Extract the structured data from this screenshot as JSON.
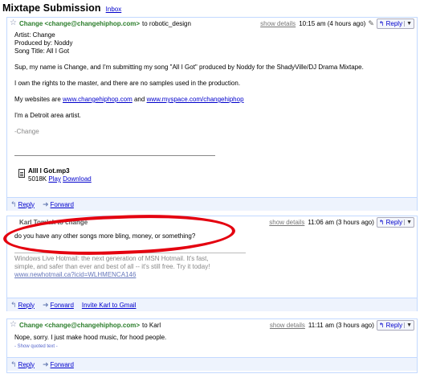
{
  "header": {
    "title": "Mixtape Submission",
    "inbox_label": "Inbox"
  },
  "messages": [
    {
      "sender": "Change <change@changehiphop.com>",
      "to": "to robotic_design",
      "show_details": "show details",
      "time": "10:15 am (4 hours ago)",
      "reply": "Reply",
      "body": {
        "artist": "Artist: Change",
        "produced_by": "Produced by: Noddy",
        "song_title": "Song Title: All I Got",
        "para1": "Sup, my name is Change, and I'm submitting my song \"All I Got\" produced by Noddy for the ShadyVille/DJ Drama Mixtape.",
        "para2": "I own the rights to the master, and there are no samples used in the production.",
        "para3_prefix": "My websites are",
        "link1": "www.changehiphop.com",
        "para3_and": "and",
        "link2": "www.myspace.com/changehiphop",
        "para4": "I'm a Detroit area artist.",
        "signature": "-Change"
      },
      "attachment": {
        "name": "AllI I Got.mp3",
        "size": "5018K",
        "play": "Play",
        "download": "Download"
      },
      "footer": {
        "reply": "Reply",
        "forward": "Forward"
      }
    },
    {
      "sender": "Karl Tomlak to change",
      "show_details": "show details",
      "time": "11:06 am (3 hours ago)",
      "reply": "Reply",
      "body": {
        "question": "do you have any other songs more bling, money, or something?",
        "ad_line1": "Windows Live Hotmail: the next generation of MSN Hotmail. It's fast,",
        "ad_line2": "simple, and safer than ever and best of all -- it's still free. Try it today!",
        "ad_link": "www.newhotmail.ca?icid=WLHMENCA146"
      },
      "footer": {
        "reply": "Reply",
        "forward": "Forward",
        "invite": "Invite Karl to Gmail"
      }
    },
    {
      "sender": "Change <change@changehiphop.com>",
      "to": "to Karl",
      "show_details": "show details",
      "time": "11:11 am (3 hours ago)",
      "reply": "Reply",
      "body": {
        "text": "Nope, sorry. I just make hood music, for hood people.",
        "show_quoted": "- Show quoted text -"
      },
      "footer": {
        "reply": "Reply",
        "forward": "Forward"
      }
    }
  ],
  "colors": {
    "sender_green": "#2a7d2a",
    "link_blue": "#0000cc",
    "border_blue": "#c3d9ff",
    "annotation_red": "#e4000f"
  }
}
